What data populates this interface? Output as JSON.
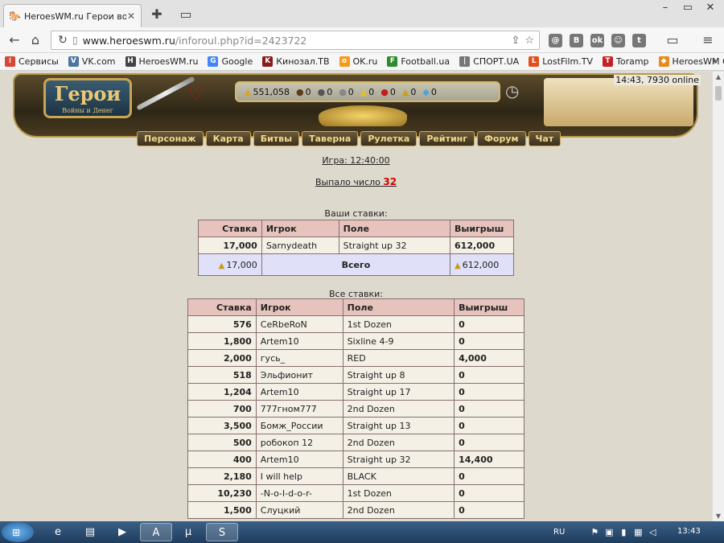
{
  "browser": {
    "tab_title": "HeroesWM.ru Герои войны и",
    "url_host": "www.heroeswm.ru",
    "url_path": "/inforoul.php?id=2423722",
    "bookmarks": [
      {
        "label": "Сервисы",
        "icon": "apps-icon",
        "color": "#d34836"
      },
      {
        "label": "VK.com",
        "icon": "vk-icon",
        "color": "#4c75a3"
      },
      {
        "label": "HeroesWM.ru",
        "icon": "heroes-icon",
        "color": "#444444"
      },
      {
        "label": "Google",
        "icon": "google-icon",
        "color": "#4285f4"
      },
      {
        "label": "Кинозал.ТВ",
        "icon": "kinozal-icon",
        "color": "#8b1a1a"
      },
      {
        "label": "OK.ru",
        "icon": "ok-icon",
        "color": "#f59a1b"
      },
      {
        "label": "Football.ua",
        "icon": "football-icon",
        "color": "#2e8b2e"
      },
      {
        "label": "СПОРТ.UA",
        "icon": "sport-icon",
        "color": "#777777"
      },
      {
        "label": "LostFilm.TV",
        "icon": "lostfilm-icon",
        "color": "#e0501b"
      },
      {
        "label": "Toramp",
        "icon": "toramp-icon",
        "color": "#c62020"
      },
      {
        "label": "HeroesWM Guide",
        "icon": "guide-icon",
        "color": "#e88a1a"
      }
    ],
    "bookmarks_more": "»",
    "extensions": [
      "@",
      "B",
      "ok",
      "☺",
      "t"
    ]
  },
  "banner": {
    "logo_title": "Герои",
    "logo_sub": "Войны и Денег",
    "resources": [
      {
        "icon": "gold-icon",
        "glyph": "▲",
        "value": "551,058"
      },
      {
        "icon": "wood-icon",
        "glyph": "●",
        "value": "0"
      },
      {
        "icon": "ore-icon",
        "glyph": "●",
        "value": "0"
      },
      {
        "icon": "mercury-icon",
        "glyph": "●",
        "value": "0"
      },
      {
        "icon": "sulfur-icon",
        "glyph": "▲",
        "value": "0"
      },
      {
        "icon": "crystal-icon",
        "glyph": "●",
        "value": "0"
      },
      {
        "icon": "gems-icon",
        "glyph": "▲",
        "value": "0"
      },
      {
        "icon": "diamond-icon",
        "glyph": "◆",
        "value": "0"
      }
    ],
    "online": "14:43, 7930 online"
  },
  "nav": [
    "Персонаж",
    "Карта",
    "Битвы",
    "Таверна",
    "Рулетка",
    "Рейтинг",
    "Форум",
    "Чат"
  ],
  "game": {
    "link": "Игра: 12:40:00",
    "result_label": "Выпало число",
    "result_number": "32"
  },
  "your_bets": {
    "caption": "Ваши ставки:",
    "headers": [
      "Ставка",
      "Игрок",
      "Поле",
      "Выигрыш"
    ],
    "rows": [
      {
        "bet": "17,000",
        "player": "Sarnydeath",
        "field": "Straight up 32",
        "win": "612,000"
      }
    ],
    "total_bet": "17,000",
    "total_label": "Всего",
    "total_win": "612,000"
  },
  "all_bets": {
    "caption": "Все ставки:",
    "headers": [
      "Ставка",
      "Игрок",
      "Поле",
      "Выигрыш"
    ],
    "rows": [
      {
        "bet": "576",
        "player": "CeRbeRoN",
        "field": "1st Dozen",
        "win": "0"
      },
      {
        "bet": "1,800",
        "player": "Artem10",
        "field": "Sixline 4-9",
        "win": "0"
      },
      {
        "bet": "2,000",
        "player": "гусь_",
        "field": "RED",
        "win": "4,000"
      },
      {
        "bet": "518",
        "player": "Эльфионит",
        "field": "Straight up 8",
        "win": "0"
      },
      {
        "bet": "1,204",
        "player": "Artem10",
        "field": "Straight up 17",
        "win": "0"
      },
      {
        "bet": "700",
        "player": "777гном777",
        "field": "2nd Dozen",
        "win": "0"
      },
      {
        "bet": "3,500",
        "player": "Бомж_России",
        "field": "Straight up 13",
        "win": "0"
      },
      {
        "bet": "500",
        "player": "робокоп 12",
        "field": "2nd Dozen",
        "win": "0"
      },
      {
        "bet": "400",
        "player": "Artem10",
        "field": "Straight up 32",
        "win": "14,400"
      },
      {
        "bet": "2,180",
        "player": "I will help",
        "field": "BLACK",
        "win": "0"
      },
      {
        "bet": "10,230",
        "player": "-N-o-l-d-o-r-",
        "field": "1st Dozen",
        "win": "0"
      },
      {
        "bet": "1,500",
        "player": "Слуцкий",
        "field": "2nd Dozen",
        "win": "0"
      }
    ]
  },
  "taskbar": {
    "lang": "RU",
    "time": "13:43"
  }
}
